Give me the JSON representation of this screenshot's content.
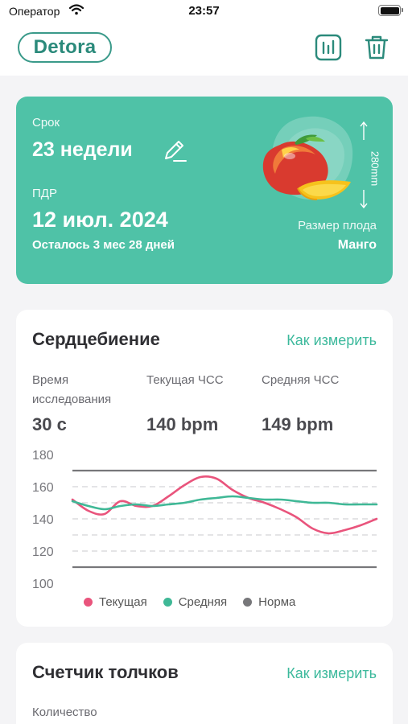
{
  "status_bar": {
    "carrier": "Оператор",
    "time": "23:57"
  },
  "nav": {
    "logo_text": "Detora"
  },
  "pregnancy": {
    "term_label": "Срок",
    "term_value": "23 недели",
    "pdr_label": "ПДР",
    "pdr_value": "12 июл. 2024",
    "remaining": "Осталось 3 мес 28 дней",
    "fruit_length": "280mm",
    "fruit_size_label": "Размер плода",
    "fruit_name": "Манго"
  },
  "heartbeat": {
    "title": "Сердцебиение",
    "how_to_link": "Как измерить",
    "metrics": [
      {
        "label": "Время исследования",
        "value": "30 с"
      },
      {
        "label": "Текущая ЧСС",
        "value": "140 bpm"
      },
      {
        "label": "Средняя ЧСС",
        "value": "149 bpm"
      }
    ]
  },
  "kicks": {
    "title": "Счетчик толчков",
    "how_to_link": "Как измерить",
    "count_label": "Количество"
  },
  "colors": {
    "accent": "#4fc2a7",
    "current": "#e9547c",
    "average": "#3fb896",
    "norm": "#77777a"
  },
  "chart_data": {
    "type": "line",
    "x": [
      0,
      1,
      2,
      3,
      4,
      5,
      6,
      7,
      8,
      9,
      10,
      11,
      12,
      13,
      14,
      15,
      16,
      17,
      18,
      19
    ],
    "series": [
      {
        "name": "Текущая",
        "color": "#e9547c",
        "values": [
          152,
          145,
          143,
          151,
          148,
          148,
          154,
          161,
          166,
          165,
          158,
          153,
          150,
          146,
          141,
          134,
          131,
          133,
          136,
          140
        ]
      },
      {
        "name": "Средняя",
        "color": "#3fb896",
        "values": [
          151,
          148,
          146,
          148,
          149,
          148,
          149,
          150,
          152,
          153,
          154,
          153,
          152,
          152,
          151,
          150,
          150,
          149,
          149,
          149
        ]
      }
    ],
    "norm": {
      "name": "Норма",
      "color": "#77777a",
      "min": 110,
      "max": 170
    },
    "yticks": [
      100,
      120,
      140,
      160,
      180
    ],
    "ylim": [
      100,
      180
    ],
    "grid": true,
    "legend": "bottom"
  }
}
